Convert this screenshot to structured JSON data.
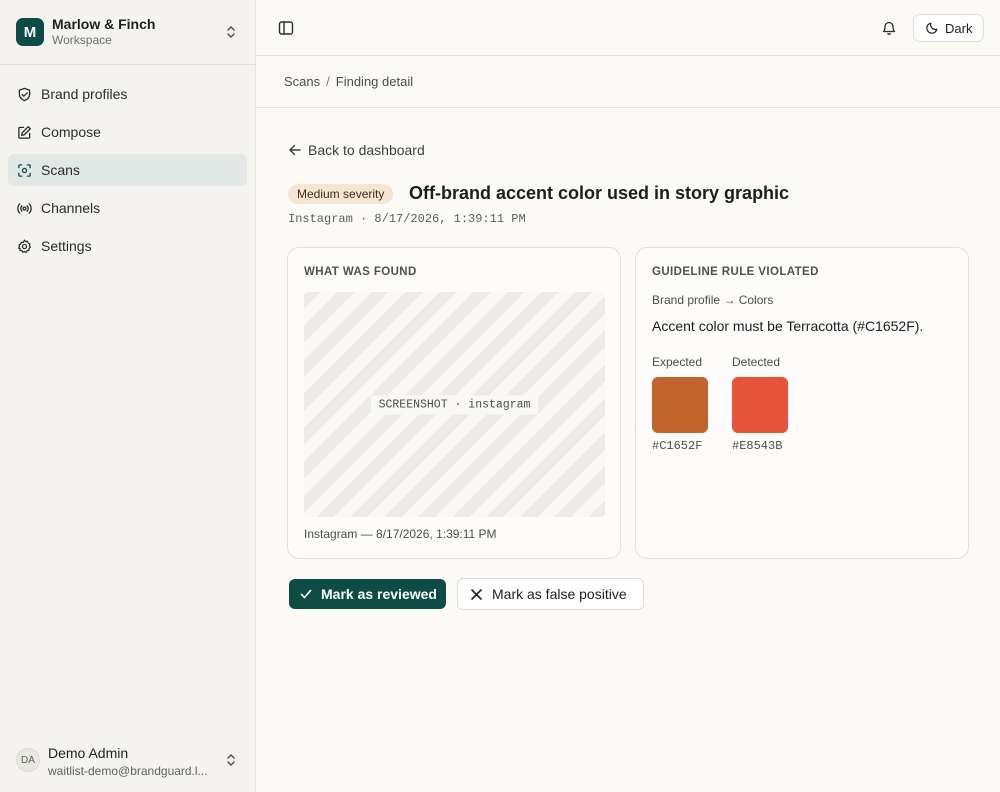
{
  "workspace": {
    "initial": "M",
    "name": "Marlow & Finch",
    "subtitle": "Workspace"
  },
  "nav": [
    {
      "label": "Brand profiles",
      "icon": "shield-check-icon",
      "active": false
    },
    {
      "label": "Compose",
      "icon": "edit-icon",
      "active": false
    },
    {
      "label": "Scans",
      "icon": "scan-icon",
      "active": true
    },
    {
      "label": "Channels",
      "icon": "broadcast-icon",
      "active": false
    },
    {
      "label": "Settings",
      "icon": "gear-icon",
      "active": false
    }
  ],
  "user": {
    "initials": "DA",
    "name": "Demo Admin",
    "email": "waitlist-demo@brandguard.l..."
  },
  "topbar": {
    "theme_label": "Dark"
  },
  "breadcrumb": {
    "parent": "Scans",
    "separator": "/",
    "current": "Finding detail"
  },
  "back_link": "Back to dashboard",
  "finding": {
    "severity": "Medium severity",
    "title": "Off-brand accent color used in story graphic",
    "meta": "Instagram · 8/17/2026, 1:39:11 PM"
  },
  "found_card": {
    "heading": "WHAT WAS FOUND",
    "screenshot_label": "SCREENSHOT · instagram",
    "caption": "Instagram — 8/17/2026, 1:39:11 PM"
  },
  "rule_card": {
    "heading": "GUIDELINE RULE VIOLATED",
    "path": "Brand profile → Colors",
    "rule": "Accent color must be Terracotta (#C1652F).",
    "expected_label": "Expected",
    "expected_hex": "#C1652F",
    "detected_label": "Detected",
    "detected_hex": "#E8543B"
  },
  "actions": {
    "reviewed": "Mark as reviewed",
    "false_positive": "Mark as false positive"
  },
  "colors": {
    "brand": "#0D4C45",
    "expected": "#C1652F",
    "detected": "#E8543B",
    "severity_bg": "#F6E5D2"
  }
}
